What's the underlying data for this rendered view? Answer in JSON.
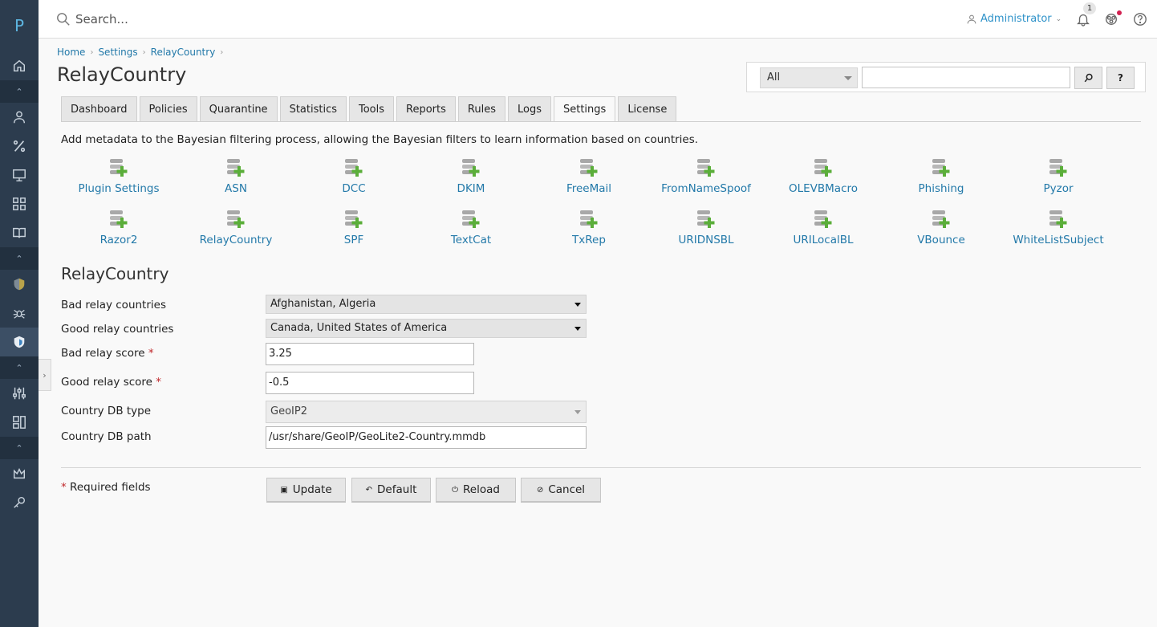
{
  "app": {
    "logo": "P"
  },
  "search": {
    "placeholder": "Search..."
  },
  "user": {
    "name": "Administrator"
  },
  "notifications": {
    "count": "1"
  },
  "breadcrumb": [
    "Home",
    "Settings",
    "RelayCountry"
  ],
  "page_title": "RelayCountry",
  "filter": {
    "select_value": "All",
    "help_label": "?"
  },
  "tabs": [
    "Dashboard",
    "Policies",
    "Quarantine",
    "Statistics",
    "Tools",
    "Reports",
    "Rules",
    "Logs",
    "Settings",
    "License"
  ],
  "active_tab": "Settings",
  "description": "Add metadata to the Bayesian filtering process, allowing the Bayesian filters to learn information based on countries.",
  "plugins": [
    "Plugin Settings",
    "ASN",
    "DCC",
    "DKIM",
    "FreeMail",
    "FromNameSpoof",
    "OLEVBMacro",
    "Phishing",
    "Pyzor",
    "Razor2",
    "RelayCountry",
    "SPF",
    "TextCat",
    "TxRep",
    "URIDNSBL",
    "URILocalBL",
    "VBounce",
    "WhiteListSubject"
  ],
  "form": {
    "title": "RelayCountry",
    "bad_relay_countries": {
      "label": "Bad relay countries",
      "value": "Afghanistan, Algeria"
    },
    "good_relay_countries": {
      "label": "Good relay countries",
      "value": "Canada, United States of America"
    },
    "bad_relay_score": {
      "label": "Bad relay score",
      "value": "3.25"
    },
    "good_relay_score": {
      "label": "Good relay score",
      "value": "-0.5"
    },
    "country_db_type": {
      "label": "Country DB type",
      "value": "GeoIP2"
    },
    "country_db_path": {
      "label": "Country DB path",
      "value": "/usr/share/GeoIP/GeoLite2-Country.mmdb"
    },
    "required_mark": "*",
    "required_note": "Required fields"
  },
  "buttons": {
    "update": "Update",
    "default": "Default",
    "reload": "Reload",
    "cancel": "Cancel"
  },
  "colors": {
    "sidebar": "#2c3c4e",
    "link": "#2379a9",
    "accent": "#2e92c9",
    "required": "#c0282b"
  }
}
